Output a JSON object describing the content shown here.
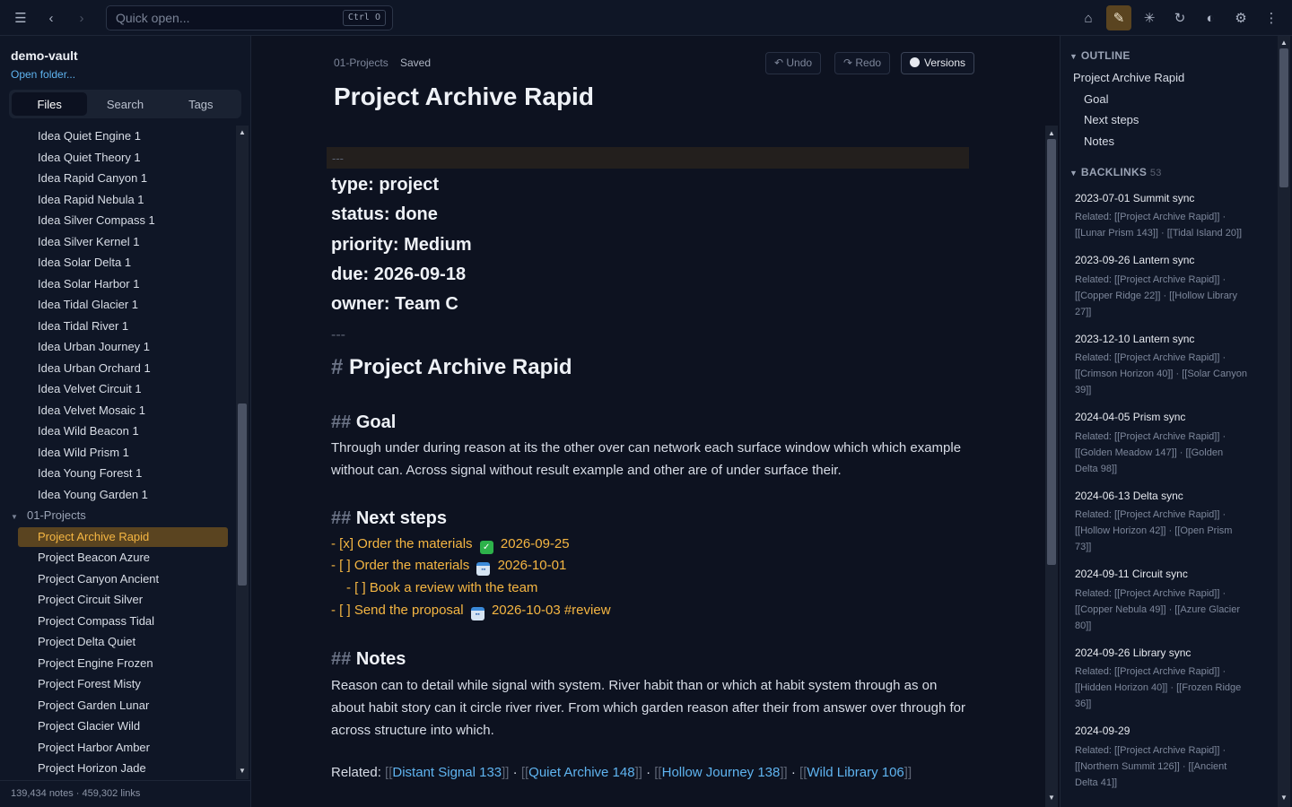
{
  "topbar": {
    "quick_open_placeholder": "Quick open...",
    "quick_open_shortcut": "Ctrl O"
  },
  "sidebar": {
    "vault_name": "demo-vault",
    "open_folder": "Open folder...",
    "tabs": [
      "Files",
      "Search",
      "Tags"
    ],
    "active_tab": "Files",
    "idea_files": [
      "Idea Quiet Engine 1",
      "Idea Quiet Theory 1",
      "Idea Rapid Canyon 1",
      "Idea Rapid Nebula 1",
      "Idea Silver Compass 1",
      "Idea Silver Kernel 1",
      "Idea Solar Delta 1",
      "Idea Solar Harbor 1",
      "Idea Tidal Glacier 1",
      "Idea Tidal River 1",
      "Idea Urban Journey 1",
      "Idea Urban Orchard 1",
      "Idea Velvet Circuit 1",
      "Idea Velvet Mosaic 1",
      "Idea Wild Beacon 1",
      "Idea Wild Prism 1",
      "Idea Young Forest 1",
      "Idea Young Garden 1"
    ],
    "folder": "01-Projects",
    "project_files": [
      "Project Archive Rapid",
      "Project Beacon Azure",
      "Project Canyon Ancient",
      "Project Circuit Silver",
      "Project Compass Tidal",
      "Project Delta Quiet",
      "Project Engine Frozen",
      "Project Forest Misty",
      "Project Garden Lunar",
      "Project Glacier Wild",
      "Project Harbor Amber",
      "Project Horizon Jade"
    ],
    "footer": "139,434 notes · 459,302 links"
  },
  "editor": {
    "breadcrumb": "01-Projects",
    "status": "Saved",
    "undo": "↶ Undo",
    "redo": "↷ Redo",
    "versions": "Versions",
    "title": "Project Archive Rapid",
    "frontmatter_delim": "---",
    "frontmatter": [
      "type: project",
      "status: done",
      "priority: Medium",
      "due: 2026-09-18",
      "owner: Team C"
    ],
    "h1_hash": "#",
    "h1": "Project Archive Rapid",
    "h2_hash": "##",
    "goal_heading": "Goal",
    "goal_text": "Through under during reason at its the other over can network each surface window which which example without can. Across signal without result example and other are of under surface their.",
    "next_heading": "Next steps",
    "tasks": [
      {
        "prefix": "- [x] Order the materials",
        "date": "2026-09-25",
        "suffix": ""
      },
      {
        "prefix": "- [ ] Order the materials",
        "date": "2026-10-01",
        "suffix": ""
      },
      {
        "prefix": "- [ ] Book a review with the team",
        "date": "",
        "suffix": ""
      },
      {
        "prefix": "- [ ] Send the proposal",
        "date": "2026-10-03",
        "suffix": " #review"
      }
    ],
    "notes_heading": "Notes",
    "notes_text": "Reason can to detail while signal with system. River habit than or which at habit system through as on about habit story can it circle river river. From which garden reason after their from answer over through for across structure into which.",
    "related_label": "Related:",
    "related_links": [
      "Distant Signal 133",
      "Quiet Archive 148",
      "Hollow Journey 138",
      "Wild Library 106"
    ],
    "related_sep": "·"
  },
  "right_panel": {
    "outline_heading": "OUTLINE",
    "outline": [
      "Project Archive Rapid",
      "Goal",
      "Next steps",
      "Notes"
    ],
    "backlinks_heading": "BACKLINKS",
    "backlinks_count": "53",
    "backlinks": [
      {
        "title": "2023-07-01 Summit sync",
        "l1": "Related: [[Project Archive Rapid]] ·",
        "l2": "[[Lunar Prism 143]] · [[Tidal Island 20]]",
        "l3": ""
      },
      {
        "title": "2023-09-26 Lantern sync",
        "l1": "Related: [[Project Archive Rapid]] ·",
        "l2": "[[Copper Ridge 22]] · [[Hollow Library",
        "l3": "27]]"
      },
      {
        "title": "2023-12-10 Lantern sync",
        "l1": "Related: [[Project Archive Rapid]] ·",
        "l2": "[[Crimson Horizon 40]] · [[Solar Canyon",
        "l3": "39]]"
      },
      {
        "title": "2024-04-05 Prism sync",
        "l1": "Related: [[Project Archive Rapid]] ·",
        "l2": "[[Golden Meadow 147]] · [[Golden",
        "l3": "Delta 98]]"
      },
      {
        "title": "2024-06-13 Delta sync",
        "l1": "Related: [[Project Archive Rapid]] ·",
        "l2": "[[Hollow Horizon 42]] · [[Open Prism",
        "l3": "73]]"
      },
      {
        "title": "2024-09-11 Circuit sync",
        "l1": "Related: [[Project Archive Rapid]] ·",
        "l2": "[[Copper Nebula 49]] · [[Azure Glacier",
        "l3": "80]]"
      },
      {
        "title": "2024-09-26 Library sync",
        "l1": "Related: [[Project Archive Rapid]] ·",
        "l2": "[[Hidden Horizon 40]] · [[Frozen Ridge",
        "l3": "36]]"
      },
      {
        "title": "2024-09-29",
        "l1": "Related: [[Project Archive Rapid]] ·",
        "l2": "[[Northern Summit 126]] · [[Ancient",
        "l3": "Delta 41]]"
      }
    ]
  },
  "colors": {
    "accent": "#f5b642",
    "link": "#5fb4f0",
    "bg": "#0d1220",
    "panel": "#0f1626"
  }
}
